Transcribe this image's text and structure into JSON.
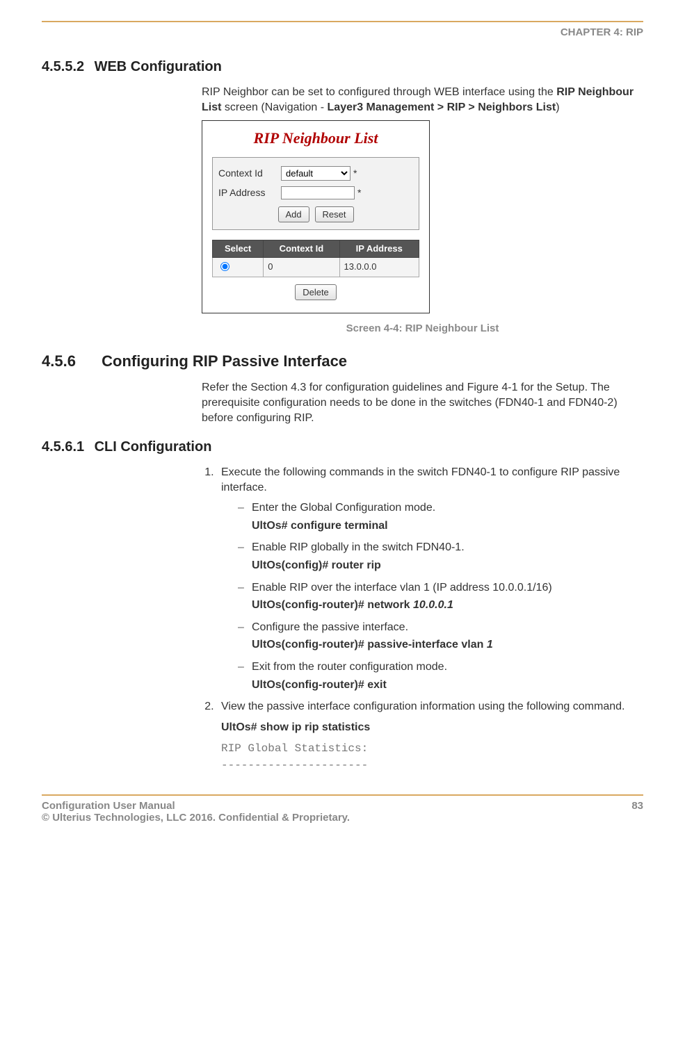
{
  "header": {
    "chapter": "CHAPTER 4: RIP"
  },
  "sections": {
    "s4552": {
      "num": "4.5.5.2",
      "title": "WEB Configuration",
      "intro_pre": "RIP Neighbor can be set to configured through WEB interface using the ",
      "intro_bold1": "RIP Neighbour List",
      "intro_mid": " screen (Navigation - ",
      "intro_bold2": "Layer3 Management > RIP > Neighbors List",
      "intro_end": ")"
    },
    "screenshot": {
      "title": "RIP Neighbour List",
      "form": {
        "context_label": "Context Id",
        "context_value": "default",
        "ip_label": "IP Address",
        "ip_value": "",
        "asterisk": "*",
        "add_btn": "Add",
        "reset_btn": "Reset"
      },
      "table": {
        "col_select": "Select",
        "col_context": "Context Id",
        "col_ip": "IP Address",
        "row0_context": "0",
        "row0_ip": "13.0.0.0"
      },
      "delete_btn": "Delete",
      "caption": "Screen 4-4: RIP Neighbour List"
    },
    "s456": {
      "num": "4.5.6",
      "title": "Configuring RIP Passive Interface",
      "para": "Refer the Section 4.3 for configuration guidelines and Figure 4-1 for the Setup. The prerequisite configuration needs to be done in the switches (FDN40-1 and FDN40-2) before configuring RIP."
    },
    "s4561": {
      "num": "4.5.6.1",
      "title": "CLI Configuration",
      "step1": "Execute the following commands in the switch FDN40-1 to configure RIP passive interface.",
      "items": {
        "i1": {
          "text": "Enter the Global Configuration mode.",
          "cmd": "UltOs# configure terminal"
        },
        "i2": {
          "text": "Enable RIP globally in the switch FDN40-1.",
          "cmd": "UltOs(config)# router rip"
        },
        "i3": {
          "text": "Enable RIP over the interface vlan 1 (IP address 10.0.0.1/16)",
          "cmd_pre": "UltOs(config-router)# network ",
          "cmd_ital": "10.0.0.1"
        },
        "i4": {
          "text": "Configure the passive interface.",
          "cmd_pre": "UltOs(config-router)# passive-interface vlan ",
          "cmd_ital": "1"
        },
        "i5": {
          "text": "Exit from the router configuration mode.",
          "cmd": "UltOs(config-router)# exit"
        }
      },
      "step2": "View the passive interface configuration information using the following command.",
      "step2_cmd": "UltOs# show ip rip statistics",
      "out1": "RIP Global Statistics:",
      "out2": "----------------------"
    }
  },
  "footer": {
    "left1": "Configuration User Manual",
    "left2": "© Ulterius Technologies, LLC 2016. Confidential & Proprietary.",
    "page": "83"
  }
}
